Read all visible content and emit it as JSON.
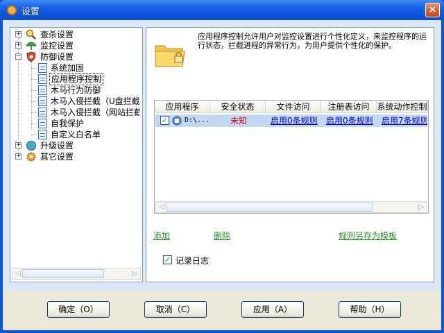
{
  "window": {
    "title": "设置",
    "close_glyph": "×"
  },
  "tree": {
    "items": [
      {
        "label": "查杀设置",
        "expander": "+"
      },
      {
        "label": "监控设置",
        "expander": "+"
      },
      {
        "label": "防御设置",
        "expander": "−"
      },
      {
        "label": "系统加固"
      },
      {
        "label": "应用程序控制"
      },
      {
        "label": "木马行为防御"
      },
      {
        "label": "木马入侵拦截（U盘拦截"
      },
      {
        "label": "木马入侵拦截（网站拦截"
      },
      {
        "label": "自我保护"
      },
      {
        "label": "自定义白名单"
      },
      {
        "label": "升级设置",
        "expander": "+"
      },
      {
        "label": "其它设置",
        "expander": "+"
      }
    ],
    "selected_index": 4
  },
  "content": {
    "description": "应用程序控制允许用户对监控设置进行个性化定义，来监控程序的运行状态，拦截进程的异常行为，为用户提供个性化的保护。",
    "columns": [
      "应用程序",
      "安全状态",
      "文件访问",
      "注册表访问",
      "系统动作控制"
    ],
    "rows": [
      {
        "checked": true,
        "app": "D:\\...",
        "status": "未知",
        "file_access": "启用0条规则",
        "registry_access": "启用0条规则",
        "system_action": "启用7条规则"
      }
    ],
    "actions": {
      "add": "添加",
      "delete": "删除",
      "save_template": "规则另存为模板"
    },
    "log": {
      "label": "记录日志",
      "checked": true
    }
  },
  "buttons": {
    "ok": "确定（O）",
    "cancel": "取消（C）",
    "apply": "应用（A）",
    "help": "帮助（H）"
  },
  "colors": {
    "title_bar": "#0b55d9",
    "client_bg": "#dce8f7",
    "status_unknown": "#d00000",
    "link": "#0000cc"
  }
}
